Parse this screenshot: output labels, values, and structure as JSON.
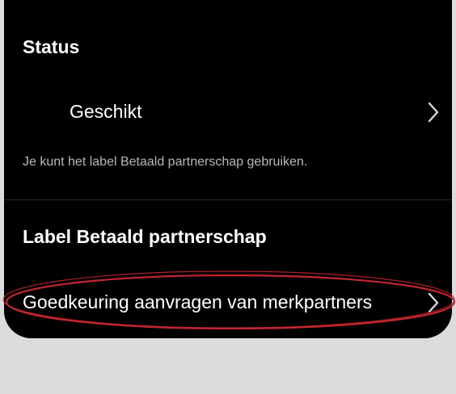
{
  "status": {
    "title": "Status",
    "value": "Geschikt",
    "hint": "Je kunt het label Betaald partnerschap gebruiken."
  },
  "paid_partnership": {
    "title": "Label Betaald partnerschap",
    "approval_label": "Goedkeuring aanvragen van merkpartners"
  },
  "icons": {
    "status_chevron": "chevron-right-icon",
    "approval_chevron": "chevron-right-icon"
  },
  "colors": {
    "panel_background": "#000000",
    "page_background": "#dcdcdc",
    "annotation_oval": "#c3262f"
  }
}
